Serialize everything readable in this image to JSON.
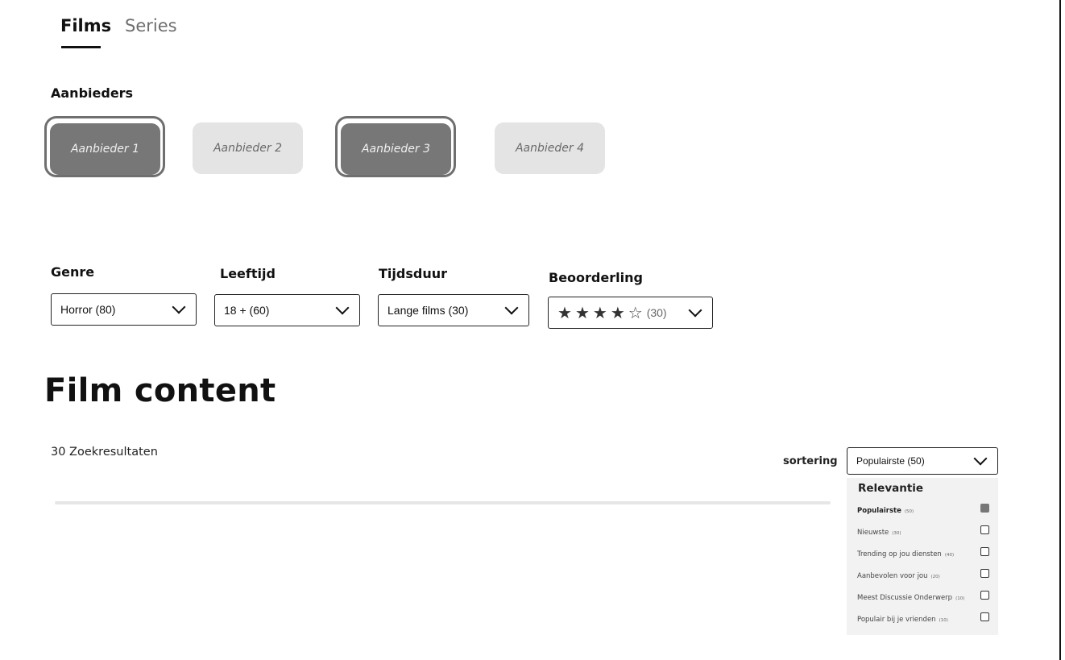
{
  "tabs": [
    {
      "label": "Films",
      "active": true
    },
    {
      "label": "Series",
      "active": false
    }
  ],
  "providers": {
    "heading": "Aanbieders",
    "items": [
      {
        "label": "Aanbieder 1",
        "selected": true
      },
      {
        "label": "Aanbieder 2",
        "selected": false
      },
      {
        "label": "Aanbieder 3",
        "selected": true
      },
      {
        "label": "Aanbieder 4",
        "selected": false
      }
    ]
  },
  "filters": {
    "genre": {
      "label": "Genre",
      "value": "Horror (80)"
    },
    "age": {
      "label": "Leeftijd",
      "value": "18 + (60)"
    },
    "duration": {
      "label": "Tijdsduur",
      "value": "Lange films (30)"
    },
    "rating": {
      "label": "Beoorderling",
      "stars_filled": 4,
      "stars_total": 5,
      "count": "(30)",
      "star_filled_icon": "★",
      "star_empty_icon": "☆"
    }
  },
  "content": {
    "title": "Film content",
    "results": "30 Zoekresultaten"
  },
  "sorting": {
    "label": "sortering",
    "value": "Populairste (50)",
    "heading": "Relevantie",
    "options": [
      {
        "label": "Populairste",
        "count": "(50)",
        "checked": true
      },
      {
        "label": "Nieuwste",
        "count": "(30)",
        "checked": false
      },
      {
        "label": "Trending op jou diensten",
        "count": "(40)",
        "checked": false
      },
      {
        "label": "Aanbevolen voor jou",
        "count": "(20)",
        "checked": false
      },
      {
        "label": "Meest Discussie Onderwerp",
        "count": "(10)",
        "checked": false
      },
      {
        "label": "Populair bij je vrienden",
        "count": "(10)",
        "checked": false
      }
    ]
  },
  "colors": {
    "selected_fill": "#777777",
    "unselected_fill": "#e4e4e4",
    "panel_bg": "#f2f2f2"
  },
  "icons": {
    "dropdown": "chevron-down-icon",
    "rating": "star-icon",
    "option": "checkbox-icon"
  }
}
